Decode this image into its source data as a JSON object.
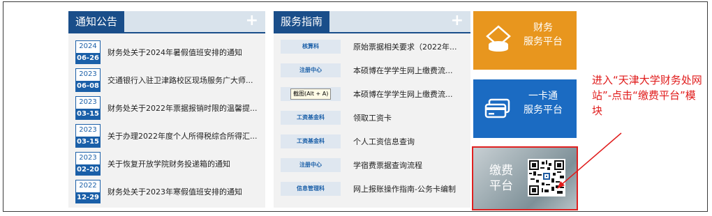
{
  "notices": {
    "title": "通知公告",
    "items": [
      {
        "year": "2024",
        "md": "06-26",
        "text": "财务处关于2024年暑假值班安排的通知"
      },
      {
        "year": "2023",
        "md": "06-08",
        "text": "交通银行入驻卫津路校区现场服务广大师..."
      },
      {
        "year": "2023",
        "md": "03-15",
        "text": "财务处关于2022年票据报销时限的温馨提..."
      },
      {
        "year": "2023",
        "md": "03-15",
        "text": "关于办理2022年度个人所得税综合所得汇..."
      },
      {
        "year": "2023",
        "md": "02-20",
        "text": "关于恢复开放学院财务投递箱的通知"
      },
      {
        "year": "2022",
        "md": "12-29",
        "text": "财务处关于2023年寒假值班安排的通知"
      }
    ]
  },
  "guide": {
    "title": "服务指南",
    "items": [
      {
        "tag": "核算科",
        "text": "原始票据相关要求（2022年..."
      },
      {
        "tag": "注册中心",
        "text": "本硕博在学学生网上缴费流..."
      },
      {
        "tag": "注册中心",
        "text": "本硕博在学学生网上缴费流..."
      },
      {
        "tag": "工资基金科",
        "text": "领取工资卡"
      },
      {
        "tag": "工资基金科",
        "text": "个人工资信息查询"
      },
      {
        "tag": "注册中心",
        "text": "学宿费票据查询流程"
      },
      {
        "tag": "信息管理科",
        "text": "网上报账操作指南-公务卡编制"
      }
    ],
    "tooltip": "截图(Alt + A)"
  },
  "tiles": {
    "finance": {
      "line1": "财务",
      "line2": "服务平台"
    },
    "card": {
      "line1": "一卡通",
      "line2": "服务平台"
    },
    "pay": {
      "line1": "缴费",
      "line2": "平台"
    }
  },
  "annotation": "进入“天津大学财务处网站”-点击“缴费平台”模块",
  "colors": {
    "primary": "#1a4e8a",
    "finance": "#e8961e",
    "card": "#1b6bc2",
    "annotation": "#e01a1a"
  }
}
